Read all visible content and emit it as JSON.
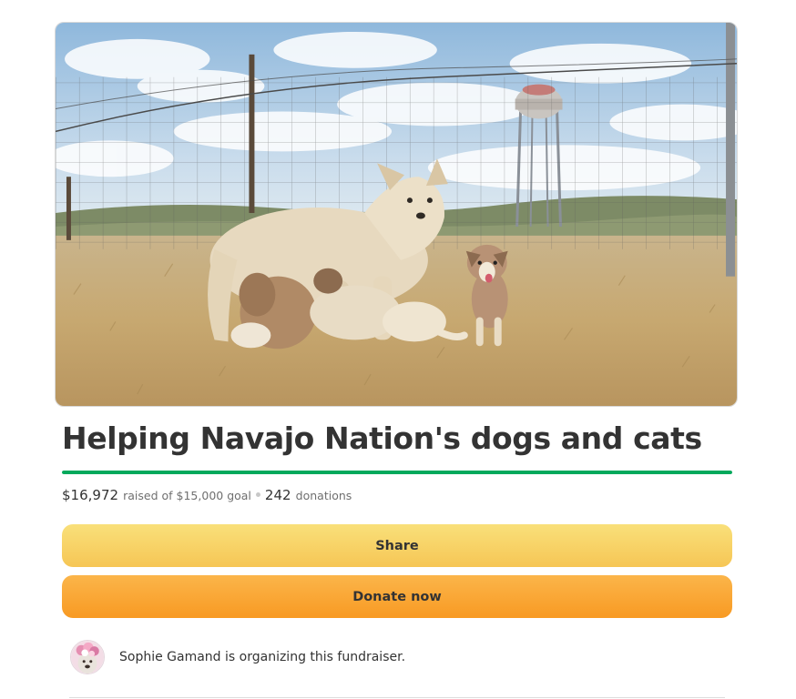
{
  "campaign": {
    "title": "Helping Navajo Nation's dogs and cats",
    "progress_percent": 100
  },
  "stats": {
    "raised": "$16,972",
    "raised_of_goal": "raised of $15,000 goal",
    "donations_count": "242",
    "donations_label": "donations"
  },
  "buttons": {
    "share": "Share",
    "donate": "Donate now"
  },
  "organizer": {
    "text": "Sophie Gamand is organizing this fundraiser."
  },
  "colors": {
    "progress": "#02a95c",
    "share_button": "#f6c655",
    "donate_button": "#f89a23"
  }
}
